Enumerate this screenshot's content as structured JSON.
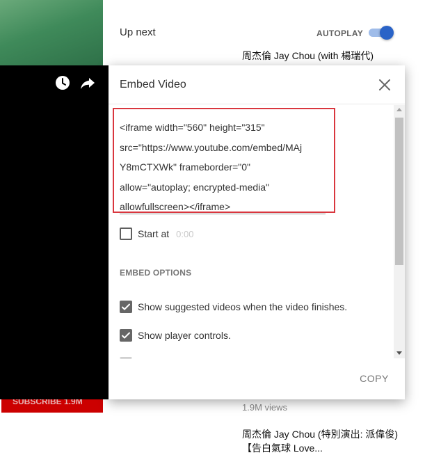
{
  "background": {
    "up_next_label": "Up next",
    "autoplay_label": "AUTOPLAY",
    "autoplay_on": true,
    "subscribe_label": "SUBSCRIBE 1.9M",
    "videos": [
      {
        "title": "周杰倫 Jay Chou (with 楊瑞代)",
        "meta": ""
      },
      {
        "title": "周杰倫 Jay Chou (特別演出: 派偉俊)【告白氣球 Love...",
        "meta": "1.9M views"
      }
    ]
  },
  "player": {
    "icons": [
      "clock-icon",
      "share-icon"
    ]
  },
  "modal": {
    "title": "Embed Video",
    "embed_lines": [
      "<iframe width=\"560\" height=\"315\"",
      "src=\"https://www.youtube.com/embed/MAj",
      "Y8mCTXWk\" frameborder=\"0\"",
      "allow=\"autoplay; encrypted-media\"",
      "allowfullscreen></iframe>"
    ],
    "start_at": {
      "label": "Start at",
      "time": "0:00",
      "checked": false
    },
    "embed_options_heading": "EMBED OPTIONS",
    "options": [
      {
        "label": "Show suggested videos when the video finishes.",
        "checked": true
      },
      {
        "label": "Show player controls.",
        "checked": true
      }
    ],
    "copy_label": "COPY"
  },
  "colors": {
    "highlight": "#d9363e",
    "autoplay_accent": "#2a63c7",
    "subscribe": "#cc0000"
  }
}
